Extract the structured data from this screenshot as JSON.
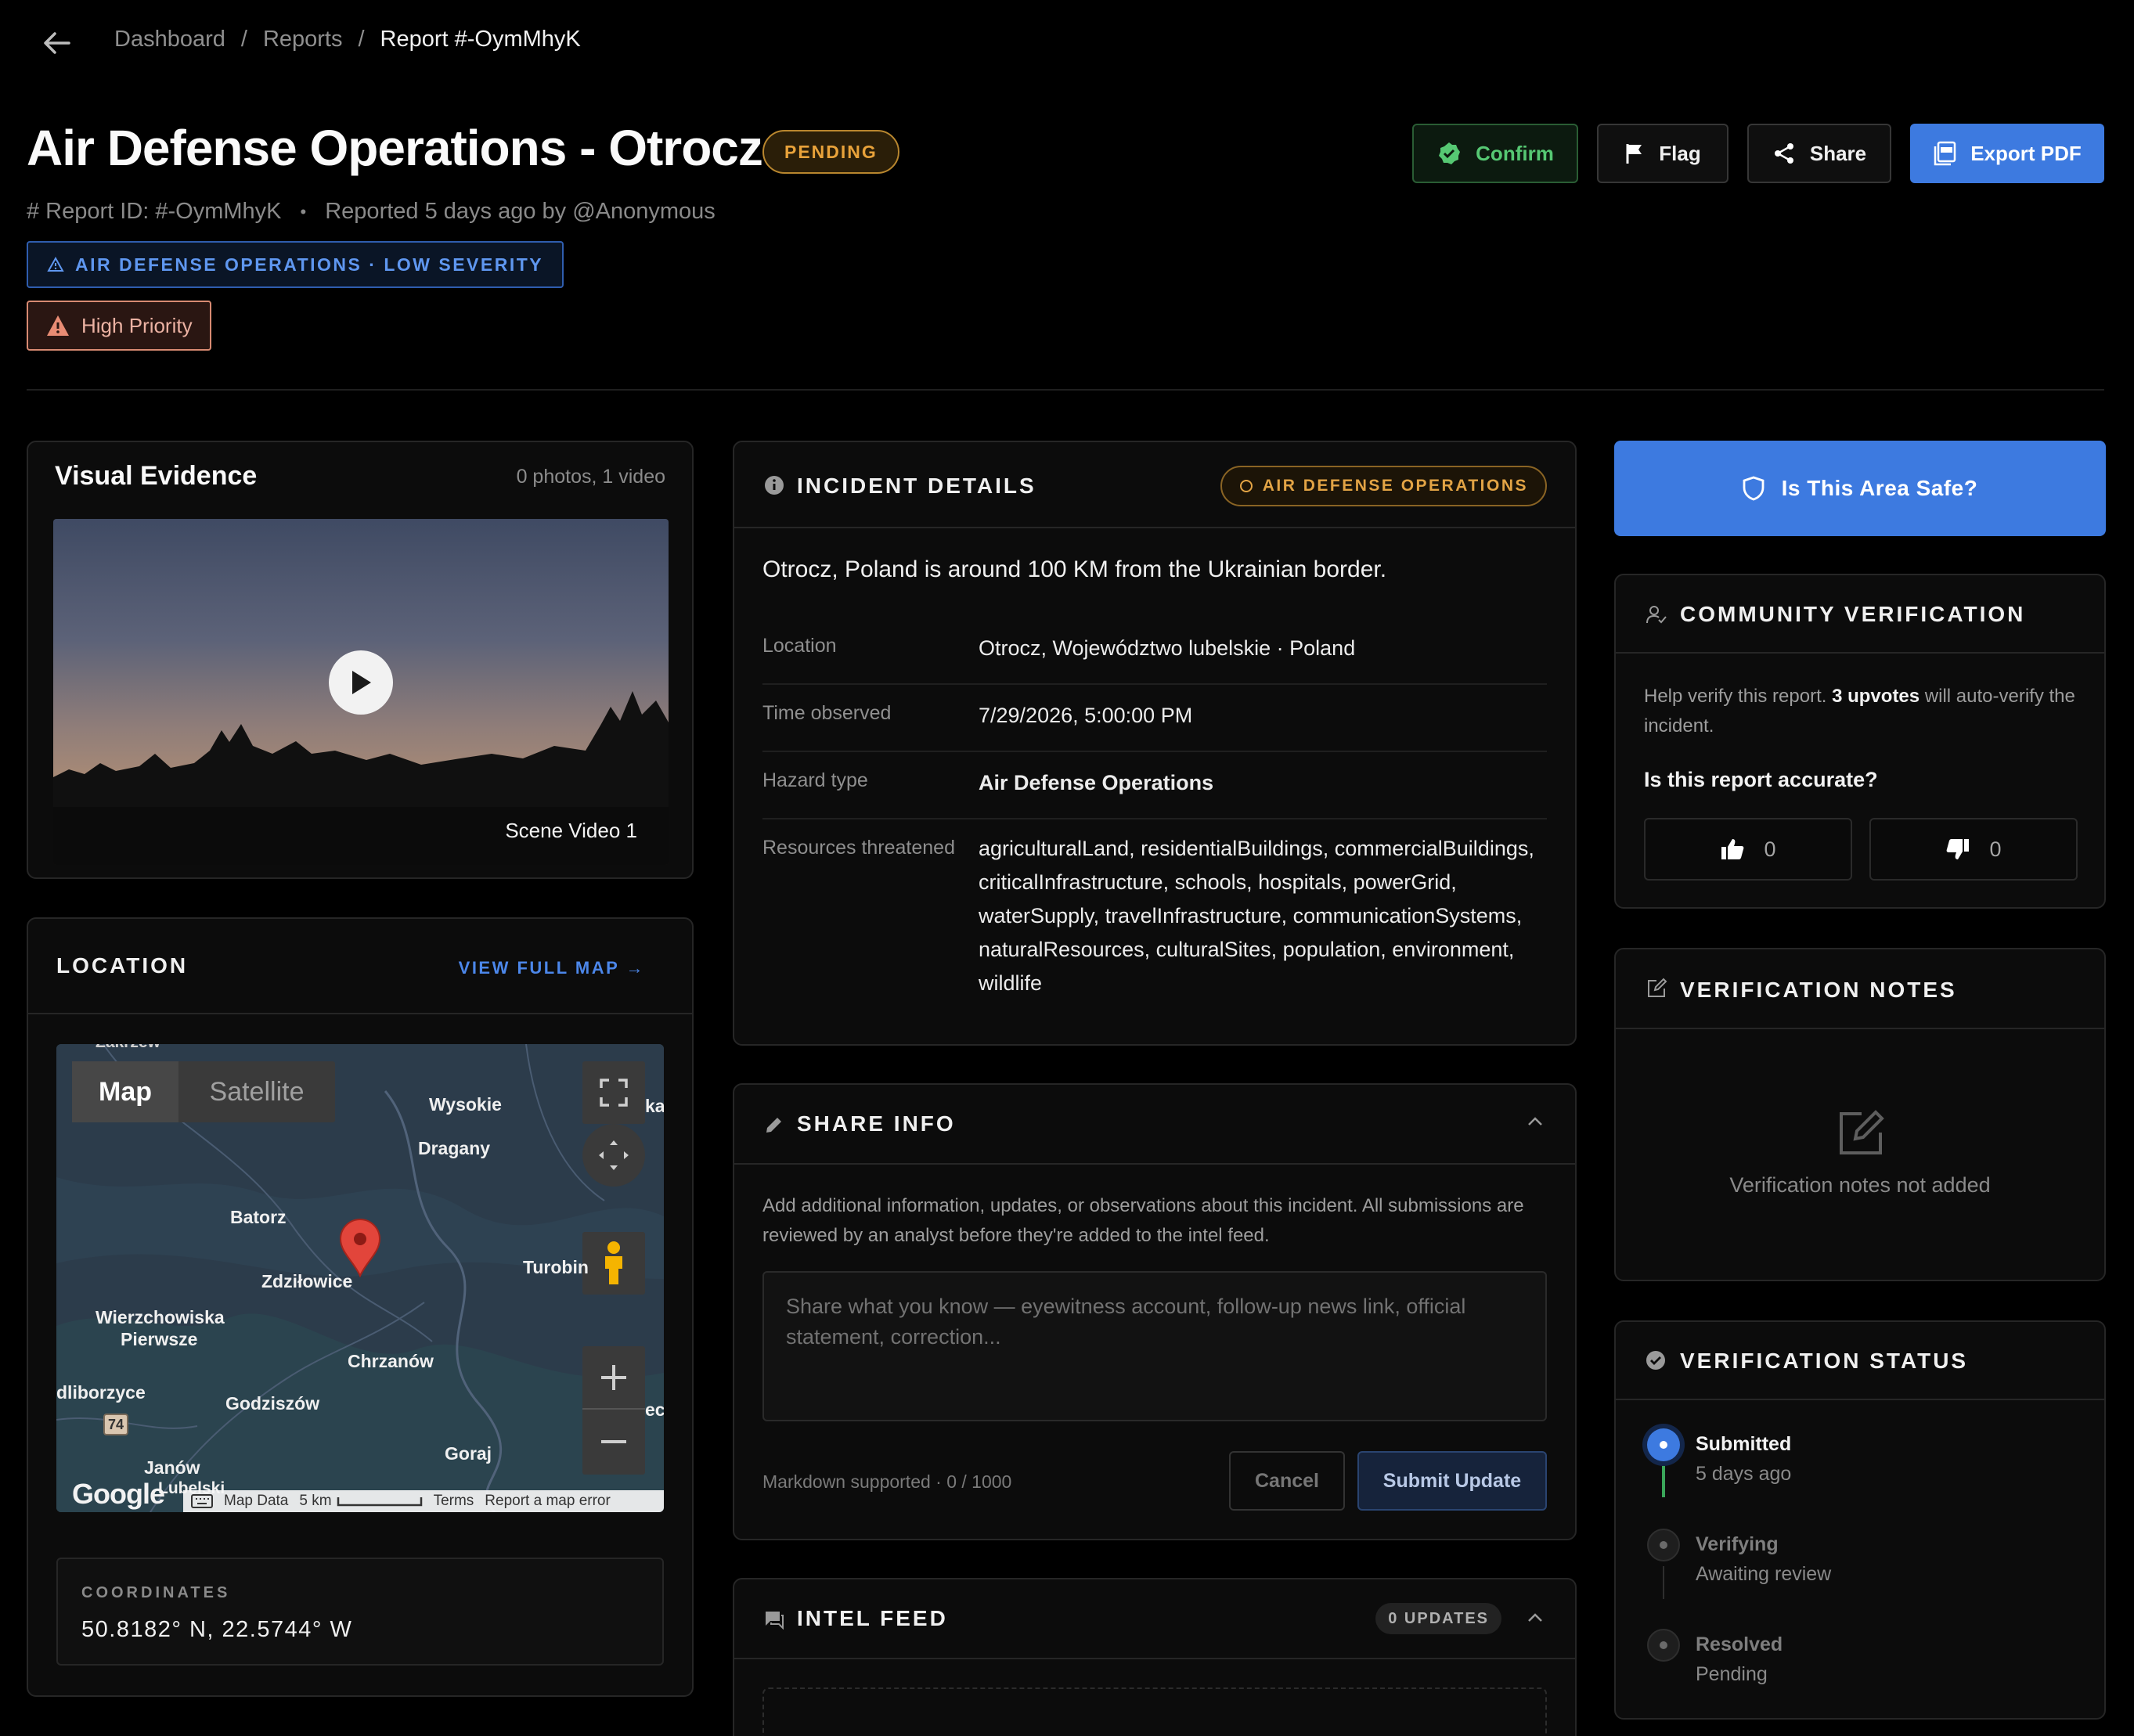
{
  "breadcrumb": [
    "Dashboard",
    "Reports",
    "Report #-OymMhyK"
  ],
  "separator": "/",
  "header": {
    "title": "Air Defense Operations - Otrocz",
    "status": "PENDING",
    "report_id": "# Report ID: #-OymMhyK",
    "reported": "Reported 5 days ago by @Anonymous",
    "category_tag": "AIR DEFENSE OPERATIONS · LOW SEVERITY",
    "priority": "High Priority"
  },
  "actions": {
    "confirm": "Confirm",
    "flag": "Flag",
    "share": "Share",
    "export": "Export PDF"
  },
  "visual_evidence": {
    "title": "Visual Evidence",
    "count": "0 photos, 1 video",
    "video_label": "Scene Video 1"
  },
  "location": {
    "title": "LOCATION",
    "view_full_map": "VIEW FULL MAP →",
    "map": {
      "tab_map": "Map",
      "tab_satellite": "Satellite",
      "places": [
        "Wysokie",
        "Dragany",
        "Batorz",
        "Zdziłowice",
        "Turobin",
        "Wierzchowiska",
        "Pierwsze",
        "Chrzanów",
        "dliborzyce",
        "Godziszów",
        "Goraj",
        "Janów",
        "Lubelski",
        "ka",
        "ec",
        "Zakrzew"
      ],
      "road_badge": "74",
      "attribution": [
        "Map Data",
        "5 km",
        "Terms",
        "Report a map error"
      ],
      "logo": "Google"
    },
    "coords_label": "COORDINATES",
    "coords_value": "50.8182° N, 22.5744° W"
  },
  "incident": {
    "title": "INCIDENT DETAILS",
    "tag": "AIR DEFENSE OPERATIONS",
    "summary": "Otrocz, Poland is around 100 KM from the Ukrainian border.",
    "rows": [
      {
        "label": "Location",
        "value": "Otrocz, Województwo lubelskie · Poland"
      },
      {
        "label": "Time observed",
        "value": "7/29/2026, 5:00:00 PM"
      },
      {
        "label": "Hazard type",
        "value": "Air Defense Operations"
      },
      {
        "label": "Resources threatened",
        "value": "agriculturalLand, residentialBuildings, commercialBuildings, criticalInfrastructure, schools, hospitals, powerGrid, waterSupply, travelInfrastructure, communicationSystems, naturalResources, culturalSites, population, environment, wildlife"
      }
    ]
  },
  "share_info": {
    "title": "SHARE INFO",
    "description": "Add additional information, updates, or observations about this incident. All submissions are reviewed by an analyst before they're added to the intel feed.",
    "placeholder": "Share what you know — eyewitness account, follow-up news link, official statement, correction...",
    "hint": "Markdown supported · 0 / 1000",
    "cancel": "Cancel",
    "submit": "Submit Update"
  },
  "intel_feed": {
    "title": "INTEL FEED",
    "count": "0 UPDATES"
  },
  "safe_button": "Is This Area Safe?",
  "community": {
    "title": "COMMUNITY VERIFICATION",
    "help_prefix": "Help verify this report.",
    "help_bold": "3 upvotes",
    "help_suffix": "will auto-verify the incident.",
    "question": "Is this report accurate?",
    "upvotes": "0",
    "downvotes": "0"
  },
  "notes": {
    "title": "VERIFICATION NOTES",
    "empty": "Verification notes not added"
  },
  "status": {
    "title": "VERIFICATION STATUS",
    "steps": [
      {
        "title": "Submitted",
        "sub": "5 days ago"
      },
      {
        "title": "Verifying",
        "sub": "Awaiting review"
      },
      {
        "title": "Resolved",
        "sub": "Pending"
      }
    ]
  },
  "colors": {
    "accent": "#3d7ae0",
    "pending": "#e8a23a",
    "confirm": "#56c873",
    "priority": "#ecb2a3",
    "background": "#000000"
  }
}
